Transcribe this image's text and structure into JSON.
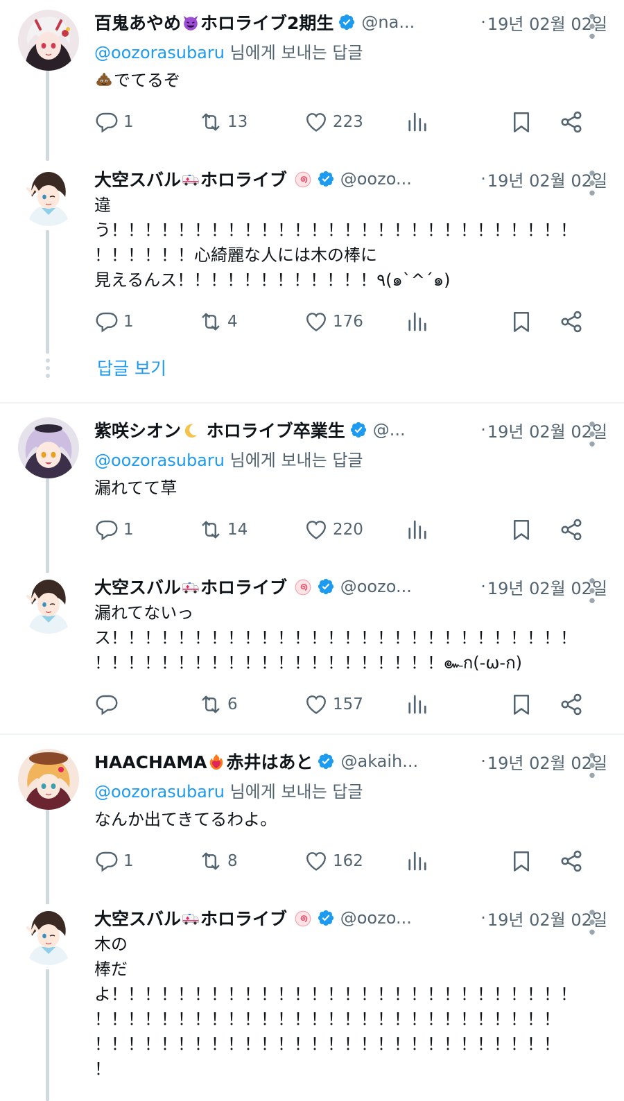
{
  "colors": {
    "accent": "#1d9bf0",
    "secondary_text": "#536471",
    "primary_text": "#0f1419",
    "thread_line": "#cfd9de",
    "divider": "#eff3f4"
  },
  "show_replies_label": "답글 보기",
  "tweets": [
    {
      "name": "百鬼あやめ",
      "name_emoji": "smiling-devil",
      "name_suffix": "ホロライブ2期生",
      "handle": "@na...",
      "date_sep": "·",
      "date": "19년 02월 02일",
      "reply_mention": "@oozorasubaru",
      "reply_suffix": " 님에게 보내는 답글",
      "text_emoji": "poop",
      "text": "でてるぞ",
      "replies": "1",
      "retweets": "13",
      "likes": "223",
      "avatar": "avatar-ayame"
    },
    {
      "name": "大空スバル",
      "name_emoji": "ambulance",
      "name_suffix": "ホロライブ",
      "name_extra_emoji": "naruto-swirl",
      "handle": "@oozo...",
      "date_sep": "·",
      "date": "19년 02월 02일",
      "text": "違\nう！！！！！！！！！！！！！！！！！！！！！！！！！！！！\n！！！！！！心綺麗な人には木の棒に\n見えるんス！！！！！！！！！！！！٩(๑`^´๑)",
      "replies": "1",
      "retweets": "4",
      "likes": "176",
      "avatar": "avatar-subaru"
    },
    {
      "name": "紫咲シオン",
      "name_emoji": "crescent-moon",
      "name_suffix": " ホロライブ卒業生",
      "handle": "@...",
      "date_sep": "·",
      "date": "19년 02월 02일",
      "reply_mention": "@oozorasubaru",
      "reply_suffix": " 님에게 보내는 답글",
      "text": "漏れてて草",
      "replies": "1",
      "retweets": "14",
      "likes": "220",
      "avatar": "avatar-shion"
    },
    {
      "name": "大空スバル",
      "name_emoji": "ambulance",
      "name_suffix": "ホロライブ",
      "name_extra_emoji": "naruto-swirl",
      "handle": "@oozo...",
      "date_sep": "·",
      "date": "19년 02월 02일",
      "text": "漏れてないっ\nス！！！！！！！！！！！！！！！！！！！！！！！！！！！！\n！！！！！！！！！！！！！！！！！！！！！๛ก(-ω-ก)",
      "replies": "",
      "retweets": "6",
      "likes": "157",
      "avatar": "avatar-subaru"
    },
    {
      "name": "HAACHAMA",
      "name_emoji": "heart-on-fire",
      "name_suffix": "赤井はあと",
      "handle": "@akaih...",
      "date_sep": "·",
      "date": "19년 02월 02일",
      "reply_mention": "@oozorasubaru",
      "reply_suffix": " 님에게 보내는 답글",
      "text": "なんか出てきてるわよ。",
      "replies": "1",
      "retweets": "8",
      "likes": "162",
      "avatar": "avatar-haato"
    },
    {
      "name": "大空スバル",
      "name_emoji": "ambulance",
      "name_suffix": "ホロライブ",
      "name_extra_emoji": "naruto-swirl",
      "handle": "@oozo...",
      "date_sep": "·",
      "date": "19년 02월 02일",
      "text": "木の\n棒だ\nよ！！！！！！！！！！！！！！！！！！！！！！！！！！！！\n！！！！！！！！！！！！！！！！！！！！！！！！！！！！\n！！！！！！！！！！！！！！！！！！！！！！！！！！！！\n！",
      "avatar": "avatar-subaru"
    }
  ]
}
